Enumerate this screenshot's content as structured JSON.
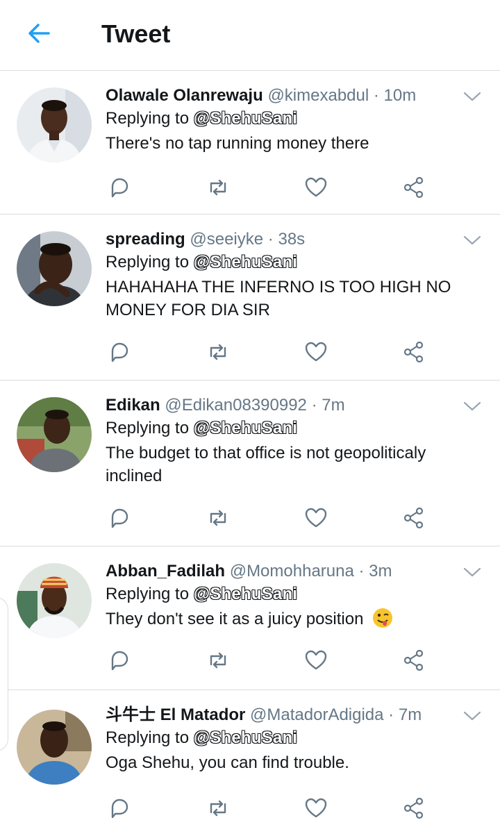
{
  "header": {
    "title": "Tweet"
  },
  "replying_label": "Replying to",
  "tweets": [
    {
      "name": "Olawale Olanrewaju",
      "handle": "@kimexabdul",
      "time": "10m",
      "reply_to": "@ShehuSani",
      "text": "There's no tap running money there",
      "avatar": "man-in-white-shirt"
    },
    {
      "name": "spreading",
      "handle": "@seeiyke",
      "time": "38s",
      "reply_to": "@ShehuSani",
      "text": "HAHAHAHA THE INFERNO IS TOO HIGH NO MONEY FOR  DIA SIR",
      "avatar": "man-selfie-car"
    },
    {
      "name": "Edikan",
      "handle": "@Edikan08390992",
      "time": "7m",
      "reply_to": "@ShehuSani",
      "text": "The budget to that office is not geopoliticaly inclined",
      "avatar": "man-grey-tshirt"
    },
    {
      "name": "Abban_Fadilah",
      "handle": "@Momohharuna",
      "time": "3m",
      "reply_to": "@ShehuSani",
      "text": "They don't see it as a juicy position",
      "emoji": "winking-face-with-tongue",
      "avatar": "man-cap-white-robe"
    },
    {
      "name": "斗牛士 El Matador",
      "handle": "@MatadorAdigida",
      "time": "7m",
      "reply_to": "@ShehuSani",
      "text": "Oga Shehu, you can find trouble.",
      "avatar": "man-blue-shirt"
    }
  ],
  "icons": {
    "back": "arrow-left-icon",
    "more": "chevron-down-icon",
    "reply": "reply-icon",
    "retweet": "retweet-icon",
    "like": "heart-icon",
    "share": "share-icon"
  },
  "colors": {
    "accent": "#1da1f2",
    "icon": "#657786",
    "divider": "#d8dde1"
  }
}
